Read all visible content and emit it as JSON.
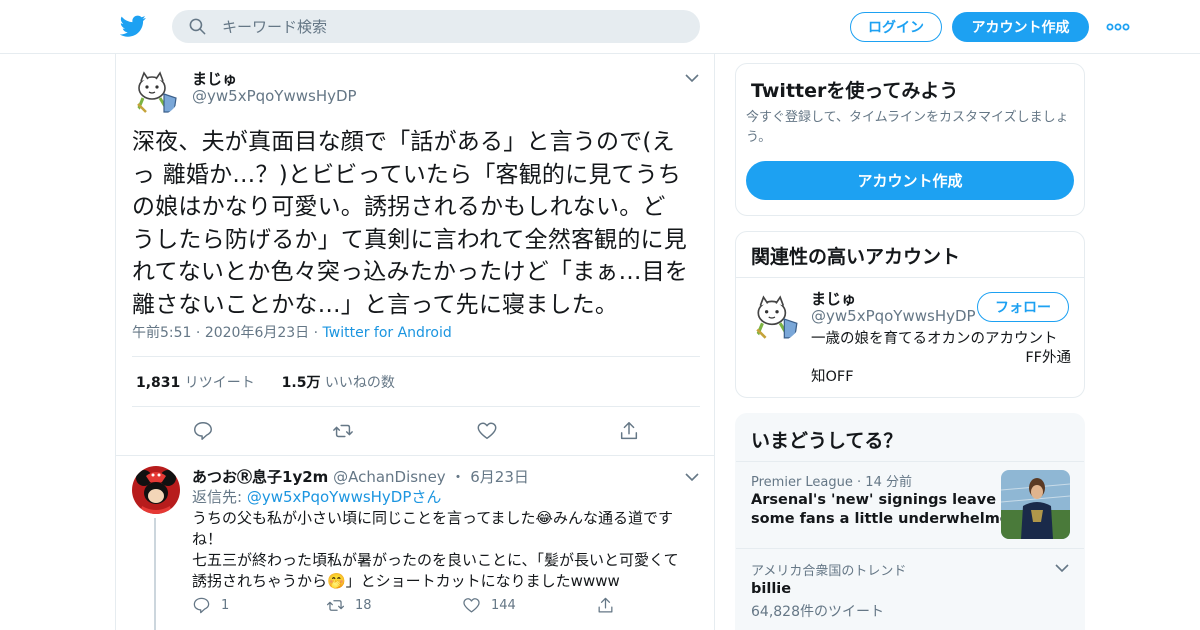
{
  "header": {
    "search_placeholder": "キーワード検索",
    "login_label": "ログイン",
    "signup_label": "アカウント作成"
  },
  "tweet": {
    "name": "まじゅ",
    "handle": "@yw5xPqoYwwsHyDP",
    "text_lines": [
      "深夜、夫が真面目な顔で「話がある」と言うので(え",
      "っ 離婚か…？)とビビっていたら「客観的に見てうち",
      "の娘はかなり可愛い。誘拐されるかもしれない。ど",
      "うしたら防げるか」て真剣に言われて全然客観的に見",
      "れてないとか色々突っ込みたかったけど「まぁ…目を",
      "離さないことかな…」と言って先に寝ました。"
    ],
    "time": "午前5:51",
    "date": "2020年6月23日",
    "source": "Twitter for Android",
    "retweets_count": "1,831",
    "retweets_label": "リツイート",
    "likes_count": "1.5万",
    "likes_label": "いいねの数"
  },
  "reply": {
    "name": "あつおⓇ息子1y2m",
    "handle": "@AchanDisney",
    "date": "6月23日",
    "reply_to_prefix": "返信先: ",
    "reply_to_handle": "@yw5xPqoYwwsHyDP",
    "reply_to_suffix": "さん",
    "text_lines": [
      "うちの父も私が小さい頃に同じことを言ってました😂みんな通る道です",
      "ね！",
      "七五三が終わった頃私が暑がったのを良いことに、「髪が長いと可愛くて",
      "誘拐されちゃうから🤭」とショートカットになりましたwwww"
    ],
    "reply_count": "1",
    "retweet_count": "18",
    "like_count": "144"
  },
  "sidebar": {
    "signup_card": {
      "title": "Twitterを使ってみよう",
      "subtitle": "今すぐ登録して、タイムラインをカスタマイズしましょう。",
      "button": "アカウント作成"
    },
    "related": {
      "title": "関連性の高いアカウント",
      "name": "まじゅ",
      "handle": "@yw5xPqoYwwsHyDP",
      "follow_label": "フォロー",
      "bio_line1": "一歳の娘を育てるオカンのアカウント",
      "bio_line2": "FF外通",
      "bio_line3": "知OFF"
    },
    "trends": {
      "title": "いまどうしてる？",
      "items": [
        {
          "context": "Premier League",
          "time": "14 分前",
          "title_line1": "Arsenal's 'new' signings leave",
          "title_line2": "some fans a little underwhelmed"
        },
        {
          "context": "アメリカ合衆国のトレンド",
          "title": "billie",
          "count": "64,828件のツイート"
        }
      ]
    }
  },
  "colors": {
    "brand": "#1da1f2",
    "link": "#1b95e0",
    "muted": "#657786"
  }
}
